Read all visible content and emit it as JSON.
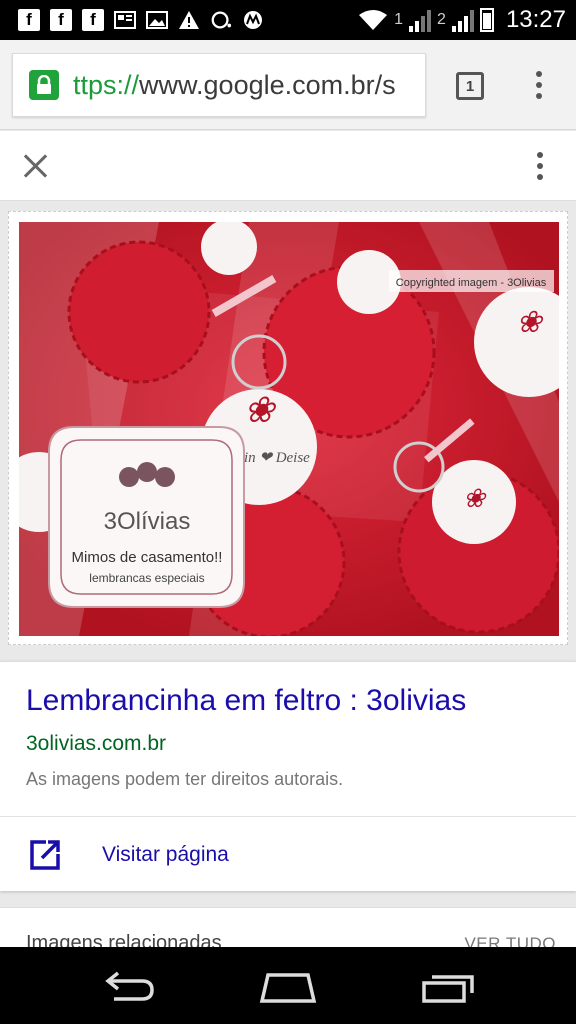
{
  "status_bar": {
    "time": "13:27",
    "sim1": "1",
    "sim2": "2",
    "notification_icons": [
      "facebook-icon",
      "facebook-icon",
      "facebook-icon",
      "gallery-icon",
      "image-icon",
      "warning-icon",
      "chat-icon",
      "motorola-icon"
    ]
  },
  "browser": {
    "url_scheme": "ttps://",
    "url_rest": "www.google.com.br/s",
    "tab_count": "1"
  },
  "image": {
    "watermark": "Copyrighted imagem - 3Olivias",
    "brand": "3Olívias",
    "tagline": "Mimos de casamento!!",
    "subtagline": "lembrancas especiais",
    "tag_names": "Davelin ❤ Deise"
  },
  "result": {
    "title": "Lembrancinha em feltro : 3olivias",
    "domain": "3olivias.com.br",
    "note": "As imagens podem ter direitos autorais.",
    "visit_label": "Visitar página"
  },
  "related": {
    "title": "Imagens relacionadas",
    "see_all": "VER TUDO"
  },
  "colors": {
    "link": "#1a0dab",
    "domain": "#006621",
    "secure": "#1fa33a",
    "felt_red": "#c81a2c"
  }
}
